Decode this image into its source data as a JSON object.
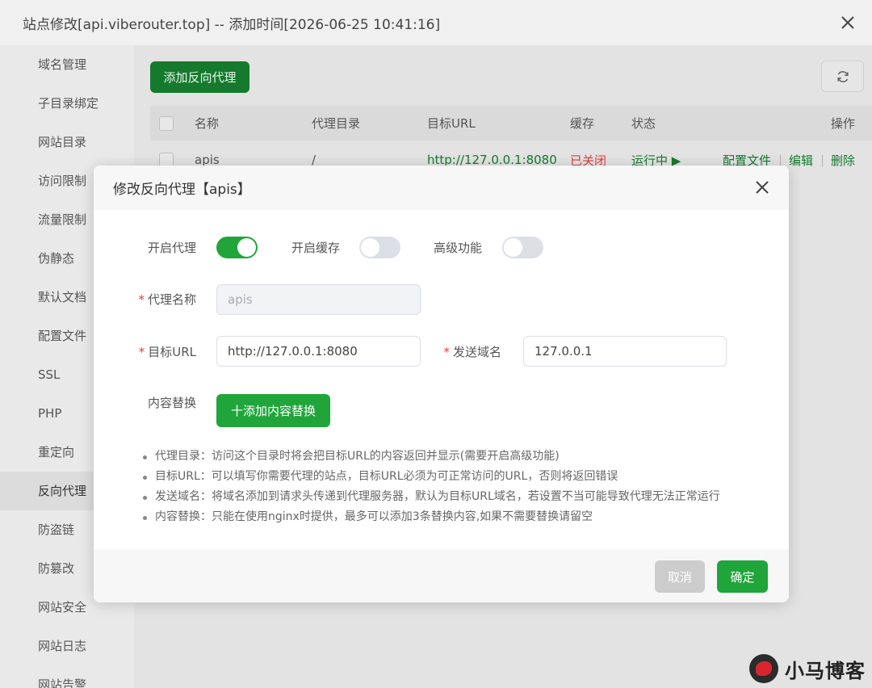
{
  "window": {
    "title": "站点修改[api.viberouter.top] -- 添加时间[2026-06-25 10:41:16]"
  },
  "sidebar": {
    "items": [
      {
        "label": "域名管理"
      },
      {
        "label": "子目录绑定"
      },
      {
        "label": "网站目录"
      },
      {
        "label": "访问限制"
      },
      {
        "label": "流量限制"
      },
      {
        "label": "伪静态"
      },
      {
        "label": "默认文档"
      },
      {
        "label": "配置文件"
      },
      {
        "label": "SSL"
      },
      {
        "label": "PHP"
      },
      {
        "label": "重定向"
      },
      {
        "label": "反向代理",
        "active": true
      },
      {
        "label": "防盗链"
      },
      {
        "label": "防篡改"
      },
      {
        "label": "网站安全"
      },
      {
        "label": "网站日志"
      },
      {
        "label": "网站告警"
      }
    ]
  },
  "content": {
    "add_button": "添加反向代理",
    "table": {
      "headers": {
        "name": "名称",
        "dir": "代理目录",
        "target": "目标URL",
        "cache": "缓存",
        "status": "状态",
        "ops": "操作"
      },
      "row": {
        "name": "apis",
        "dir": "/",
        "target": "http://127.0.0.1:8080",
        "cache": "已关闭",
        "status": "运行中 ▶",
        "op_config": "配置文件",
        "op_sep": "|",
        "op_edit": "编辑",
        "op_delete": "删除"
      }
    }
  },
  "modal": {
    "title": "修改反向代理【apis】",
    "toggles": {
      "enable_proxy": {
        "label": "开启代理",
        "on": true
      },
      "enable_cache": {
        "label": "开启缓存",
        "on": false
      },
      "advanced": {
        "label": "高级功能",
        "on": false
      }
    },
    "fields": {
      "proxy_name": {
        "label": "代理名称",
        "value": "apis",
        "required": "*"
      },
      "target_url": {
        "label": "目标URL",
        "value": "http://127.0.0.1:8080",
        "required": "*"
      },
      "send_domain": {
        "label": "发送域名",
        "value": "127.0.0.1",
        "required": "*"
      }
    },
    "content_replace": {
      "label": "内容替换",
      "button": "十添加内容替换"
    },
    "tips": [
      "代理目录：访问这个目录时将会把目标URL的内容返回并显示(需要开启高级功能)",
      "目标URL：可以填写你需要代理的站点，目标URL必须为可正常访问的URL，否则将返回错误",
      "发送域名：将域名添加到请求头传递到代理服务器，默认为目标URL域名，若设置不当可能导致代理无法正常运行",
      "内容替换：只能在使用nginx时提供，最多可以添加3条替换内容,如果不需要替换请留空"
    ],
    "cancel": "取消",
    "confirm": "确定"
  },
  "watermark": {
    "text": "小马博客"
  },
  "colors": {
    "accent": "#20a53a",
    "dark_accent": "#157a2d",
    "danger": "#e23c3c"
  }
}
